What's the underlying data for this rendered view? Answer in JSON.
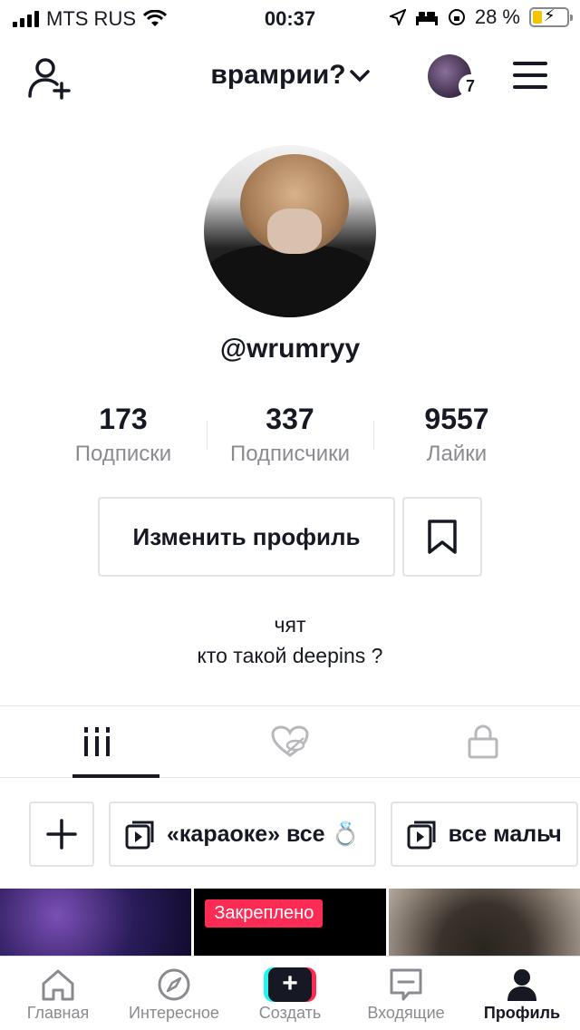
{
  "status_bar": {
    "carrier": "MTS RUS",
    "time": "00:37",
    "battery": "28 %",
    "battery_level": 0.28
  },
  "header": {
    "title": "врамрии?",
    "story_count": "7"
  },
  "profile": {
    "username": "@wrumryy",
    "stats": [
      {
        "value": "173",
        "label": "Подписки"
      },
      {
        "value": "337",
        "label": "Подписчики"
      },
      {
        "value": "9557",
        "label": "Лайки"
      }
    ],
    "edit_button": "Изменить профиль",
    "bio_line1": "чят",
    "bio_line2": "кто такой deepins ?"
  },
  "playlists": [
    {
      "label": "«караоке» все 💍"
    },
    {
      "label": "все мальч"
    }
  ],
  "thumbnails": {
    "pinned_label": "Закреплено"
  },
  "bottom_nav": [
    {
      "label": "Главная",
      "icon": "home-icon"
    },
    {
      "label": "Интересное",
      "icon": "compass-icon"
    },
    {
      "label": "Создать",
      "icon": "create-icon"
    },
    {
      "label": "Входящие",
      "icon": "inbox-icon"
    },
    {
      "label": "Профиль",
      "icon": "profile-icon"
    }
  ],
  "colors": {
    "accent": "#fe2c55",
    "secondary_accent": "#25f4ee",
    "text": "#161823",
    "muted": "#8a8b91"
  }
}
